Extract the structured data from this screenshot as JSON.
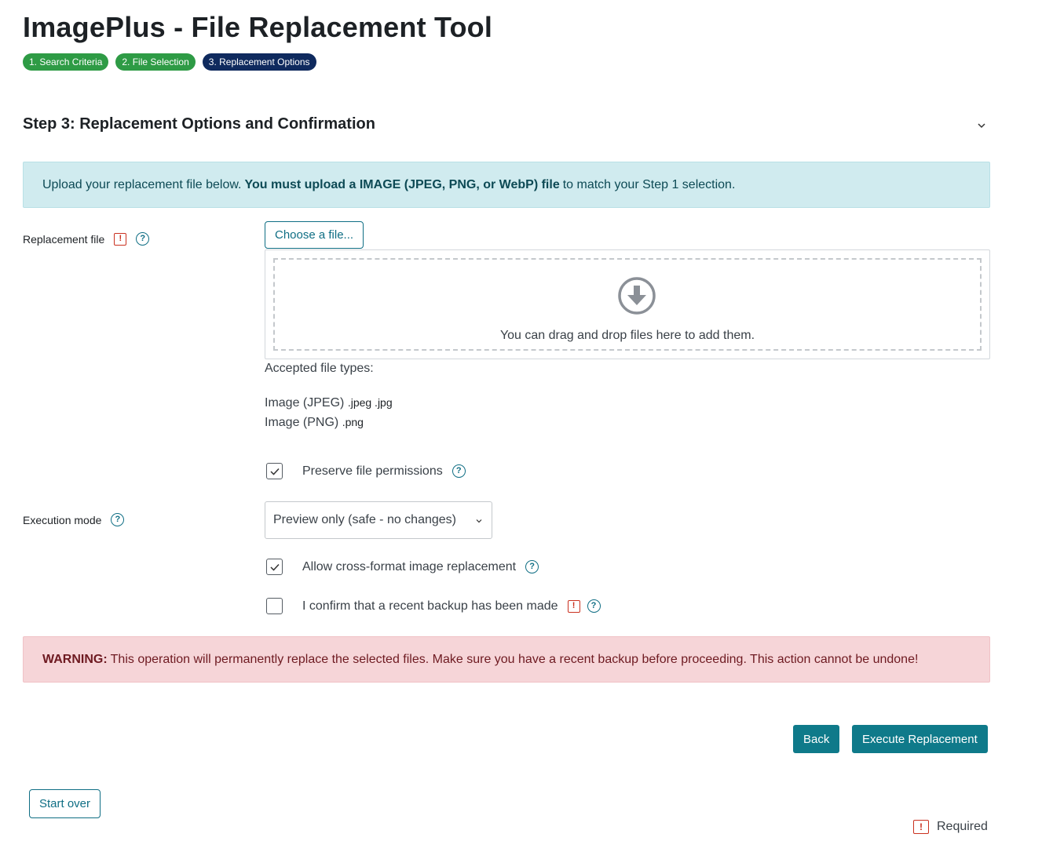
{
  "page": {
    "title": "ImagePlus - File Replacement Tool"
  },
  "steps": [
    {
      "label": "1. Search Criteria",
      "status": "done"
    },
    {
      "label": "2. File Selection",
      "status": "done"
    },
    {
      "label": "3. Replacement Options",
      "status": "current"
    }
  ],
  "section": {
    "title": "Step 3: Replacement Options and Confirmation"
  },
  "info_alert": {
    "prefix": "Upload your replacement file below.",
    "bold": "You must upload a IMAGE (JPEG, PNG, or WebP) file",
    "suffix": "to match your Step 1 selection."
  },
  "replacement_file": {
    "label": "Replacement file",
    "choose_button": "Choose a file...",
    "drop_text": "You can drag and drop files here to add them.",
    "accepted_title": "Accepted file types:",
    "accepted_types": [
      {
        "name": "Image (JPEG)",
        "ext": ".jpeg .jpg"
      },
      {
        "name": "Image (PNG)",
        "ext": ".png"
      }
    ]
  },
  "preserve_permissions": {
    "label": "Preserve file permissions",
    "checked": true
  },
  "execution_mode": {
    "label": "Execution mode",
    "selected": "Preview only (safe - no changes)"
  },
  "cross_format": {
    "label": "Allow cross-format image replacement",
    "checked": true
  },
  "backup_confirm": {
    "label": "I confirm that a recent backup has been made",
    "checked": false
  },
  "warning": {
    "strong": "WARNING:",
    "text": "This operation will permanently replace the selected files. Make sure you have a recent backup before proceeding. This action cannot be undone!"
  },
  "buttons": {
    "back": "Back",
    "execute": "Execute Replacement",
    "start_over": "Start over"
  },
  "legend": {
    "required": "Required"
  },
  "icons": {
    "required": "required-icon",
    "help": "help-icon",
    "download": "download-arrow-icon",
    "chevron": "chevron-down-icon",
    "check": "check-icon"
  },
  "colors": {
    "step_done": "#2e9b45",
    "step_current": "#0f2a5e",
    "primary": "#0f7a8a",
    "info_bg": "#d0ebef",
    "danger_bg": "#f6d5d8",
    "required": "#ca3120"
  }
}
